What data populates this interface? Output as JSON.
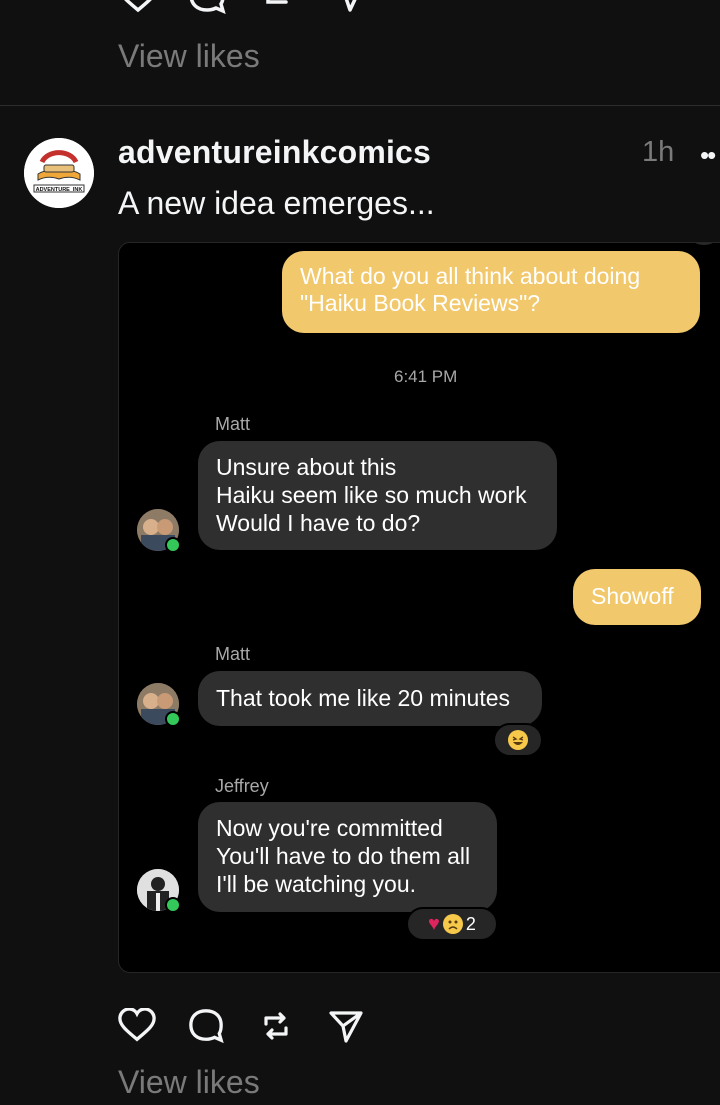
{
  "previous_post": {
    "view_likes": "View likes"
  },
  "post": {
    "username": "adventureinkcomics",
    "time": "1h",
    "more_glyph": "••",
    "caption": "A new idea emerges...",
    "avatar_logo_text": "ADVENTURE_INK",
    "view_likes": "View likes"
  },
  "chat": {
    "messages": [
      {
        "from": "me",
        "text": "What do you all think about doing \"Haiku Book Reviews\"?"
      },
      {
        "type": "time",
        "text": "6:41 PM"
      },
      {
        "from": "Matt",
        "sender": "Matt",
        "lines": [
          "Unsure about this",
          "Haiku seem like so much work",
          "Would I have to do?"
        ]
      },
      {
        "from": "me",
        "text": "Showoff"
      },
      {
        "from": "Matt",
        "sender": "Matt",
        "text": "That took me like 20 minutes",
        "reaction": "laughing-face"
      },
      {
        "from": "Jeffrey",
        "sender": "Jeffrey",
        "lines": [
          "Now you're committed",
          "You'll have to do them all",
          "I'll be watching you."
        ],
        "reactions": [
          "heart",
          "sad-face"
        ],
        "reaction_count": "2"
      }
    ]
  },
  "colors": {
    "bg": "#101010",
    "my_bubble": "#f2c86c",
    "their_bubble": "#2f2f2f",
    "muted_text": "#7a7a7a",
    "online": "#34c759",
    "heart": "#e0245e"
  },
  "icons": [
    "heart-icon",
    "comment-icon",
    "repost-icon",
    "share-icon"
  ]
}
